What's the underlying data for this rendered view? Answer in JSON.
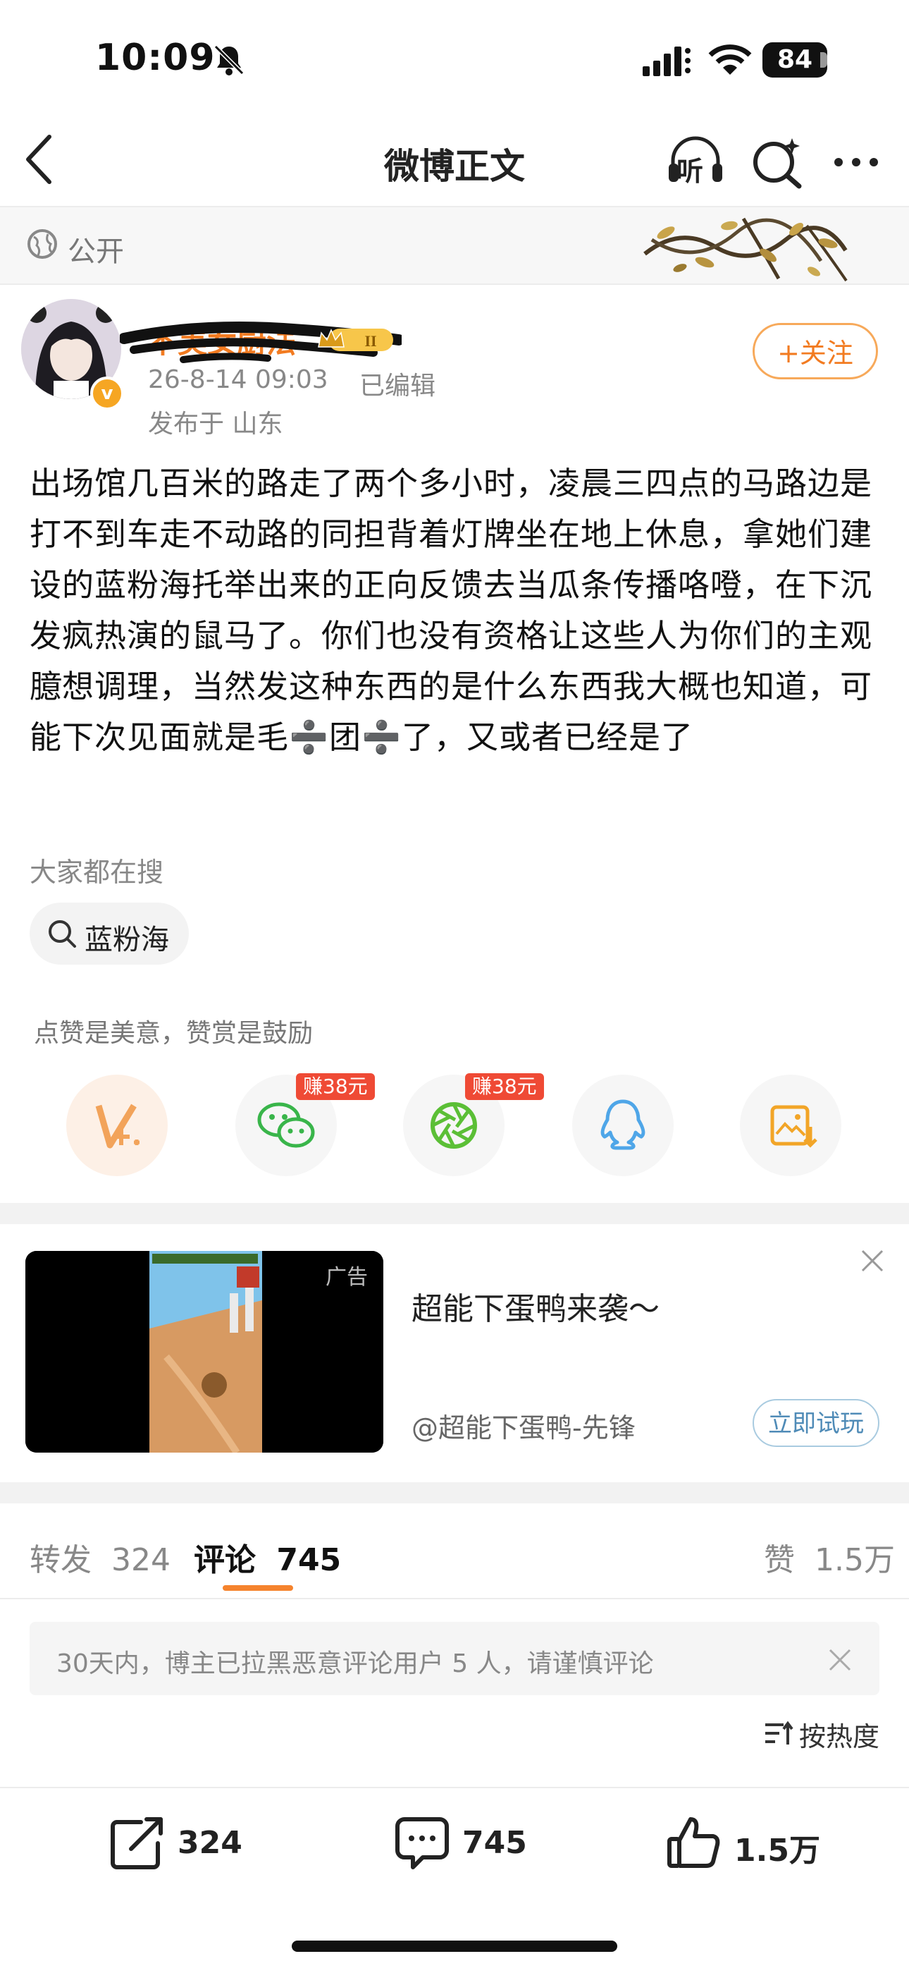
{
  "status_bar": {
    "time": "10:09",
    "battery": "84"
  },
  "nav": {
    "title": "微博正文",
    "listen_label": "听"
  },
  "visibility": {
    "label": "公开"
  },
  "user": {
    "name": "不美女厨法",
    "badge": "II",
    "verified_mark": "v",
    "time": "26-8-14 09:03",
    "edited": "已编辑",
    "location": "发布于 山东",
    "follow_label": "+关注"
  },
  "post": {
    "body": "出场馆几百米的路走了两个多小时，凌晨三四点的马路边是打不到车走不动路的同担背着灯牌坐在地上休息，拿她们建设的蓝粉海托举出来的正向反馈去当瓜条传播咯噔，在下沉发疯热演的鼠马了。你们也没有资格让这些人为你们的主观臆想调理，当然发这种东西的是什么东西我大概也知道，可能下次见面就是毛➗团➗了，又或者已经是了"
  },
  "hot_search": {
    "title": "大家都在搜",
    "term": "蓝粉海"
  },
  "reward": {
    "text": "点赞是美意，赞赏是鼓励",
    "share_targets": [
      {
        "name": "reward",
        "earn": ""
      },
      {
        "name": "wechat",
        "earn": "赚38元"
      },
      {
        "name": "moments",
        "earn": "赚38元"
      },
      {
        "name": "qq",
        "earn": ""
      },
      {
        "name": "save-image",
        "earn": ""
      }
    ]
  },
  "ad": {
    "tag": "广告",
    "title": "超能下蛋鸭来袭～",
    "source": "@超能下蛋鸭-先锋",
    "cta": "立即试玩"
  },
  "tabs": {
    "repost_label": "转发",
    "repost_count": "324",
    "comment_label": "评论",
    "comment_count": "745",
    "like_label": "赞",
    "like_count": "1.5万"
  },
  "notice": {
    "text": "30天内，博主已拉黑恶意评论用户 5 人，请谨慎评论"
  },
  "sort": {
    "label": "按热度"
  },
  "bottom_bar": {
    "repost": "324",
    "comment": "745",
    "like": "1.5万"
  },
  "colors": {
    "accent": "#f27b21",
    "earn_tag": "#ef4a35",
    "link": "#4f8bb7"
  }
}
